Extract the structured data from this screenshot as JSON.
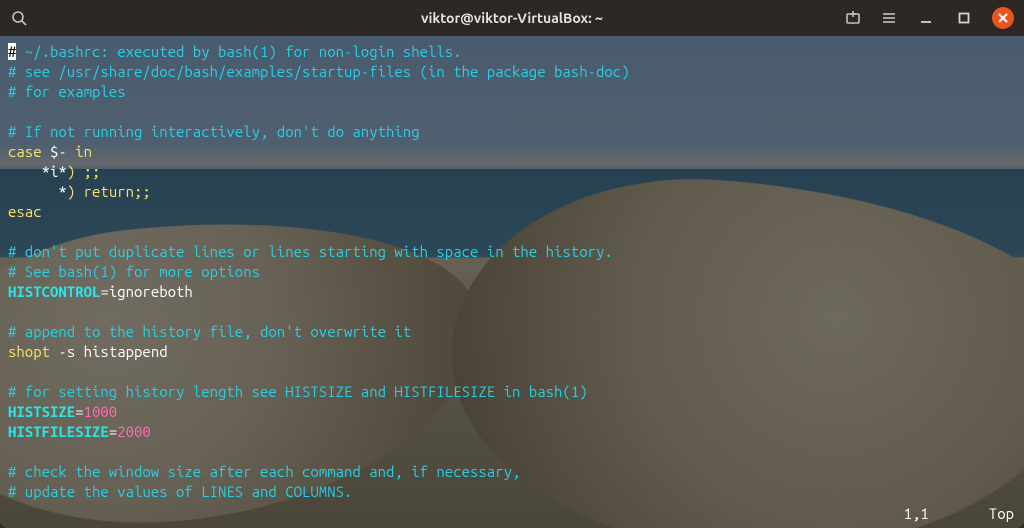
{
  "window": {
    "title": "viktor@viktor-VirtualBox: ~"
  },
  "titlebar_icons": {
    "search": "search-icon",
    "new_tab": "new-tab-icon",
    "menu": "hamburger-icon",
    "minimize": "minimize-icon",
    "maximize": "maximize-icon",
    "close": "close-icon"
  },
  "colors": {
    "comment": "#25d0e6",
    "keyword": "#f7e36a",
    "variable": "#29e6e6",
    "number": "#ff6fb3",
    "text": "#ffffff",
    "close_btn": "#e95420"
  },
  "editor_status": {
    "position": "1,1",
    "scroll": "Top"
  },
  "file_lines": [
    {
      "tokens": [
        {
          "cls": "c-comment",
          "t": "# ~/.bashrc: executed by bash(1) for non-login shells."
        }
      ]
    },
    {
      "tokens": [
        {
          "cls": "c-comment",
          "t": "# see /usr/share/doc/bash/examples/startup-files (in the package bash-doc)"
        }
      ]
    },
    {
      "tokens": [
        {
          "cls": "c-comment",
          "t": "# for examples"
        }
      ]
    },
    {
      "tokens": []
    },
    {
      "tokens": [
        {
          "cls": "c-comment",
          "t": "# If not running interactively, don't do anything"
        }
      ]
    },
    {
      "tokens": [
        {
          "cls": "c-keyword",
          "t": "case"
        },
        {
          "cls": "c-value",
          "t": " $- "
        },
        {
          "cls": "c-keyword",
          "t": "in"
        }
      ]
    },
    {
      "tokens": [
        {
          "cls": "c-value",
          "t": "    *i*"
        },
        {
          "cls": "c-keyword",
          "t": ")"
        },
        {
          "cls": "c-value",
          "t": " "
        },
        {
          "cls": "c-keyword",
          "t": ";;"
        }
      ]
    },
    {
      "tokens": [
        {
          "cls": "c-value",
          "t": "      *"
        },
        {
          "cls": "c-keyword",
          "t": ")"
        },
        {
          "cls": "c-value",
          "t": " "
        },
        {
          "cls": "c-keyword",
          "t": "return"
        },
        {
          "cls": "c-keyword",
          "t": ";;"
        }
      ]
    },
    {
      "tokens": [
        {
          "cls": "c-keyword",
          "t": "esac"
        }
      ]
    },
    {
      "tokens": []
    },
    {
      "tokens": [
        {
          "cls": "c-comment",
          "t": "# don't put duplicate lines or lines starting with space in the history."
        }
      ]
    },
    {
      "tokens": [
        {
          "cls": "c-comment",
          "t": "# See bash(1) for more options"
        }
      ]
    },
    {
      "tokens": [
        {
          "cls": "c-var",
          "t": "HISTCONTROL"
        },
        {
          "cls": "c-punc",
          "t": "="
        },
        {
          "cls": "c-value",
          "t": "ignoreboth"
        }
      ]
    },
    {
      "tokens": []
    },
    {
      "tokens": [
        {
          "cls": "c-comment",
          "t": "# append to the history file, don't overwrite it"
        }
      ]
    },
    {
      "tokens": [
        {
          "cls": "c-keyword",
          "t": "shopt"
        },
        {
          "cls": "c-value",
          "t": " -s histappend"
        }
      ]
    },
    {
      "tokens": []
    },
    {
      "tokens": [
        {
          "cls": "c-comment",
          "t": "# for setting history length see HISTSIZE and HISTFILESIZE in bash(1)"
        }
      ]
    },
    {
      "tokens": [
        {
          "cls": "c-var",
          "t": "HISTSIZE"
        },
        {
          "cls": "c-punc",
          "t": "="
        },
        {
          "cls": "c-num",
          "t": "1000"
        }
      ]
    },
    {
      "tokens": [
        {
          "cls": "c-var",
          "t": "HISTFILESIZE"
        },
        {
          "cls": "c-punc",
          "t": "="
        },
        {
          "cls": "c-num",
          "t": "2000"
        }
      ]
    },
    {
      "tokens": []
    },
    {
      "tokens": [
        {
          "cls": "c-comment",
          "t": "# check the window size after each command and, if necessary,"
        }
      ]
    },
    {
      "tokens": [
        {
          "cls": "c-comment",
          "t": "# update the values of LINES and COLUMNS."
        }
      ]
    }
  ]
}
